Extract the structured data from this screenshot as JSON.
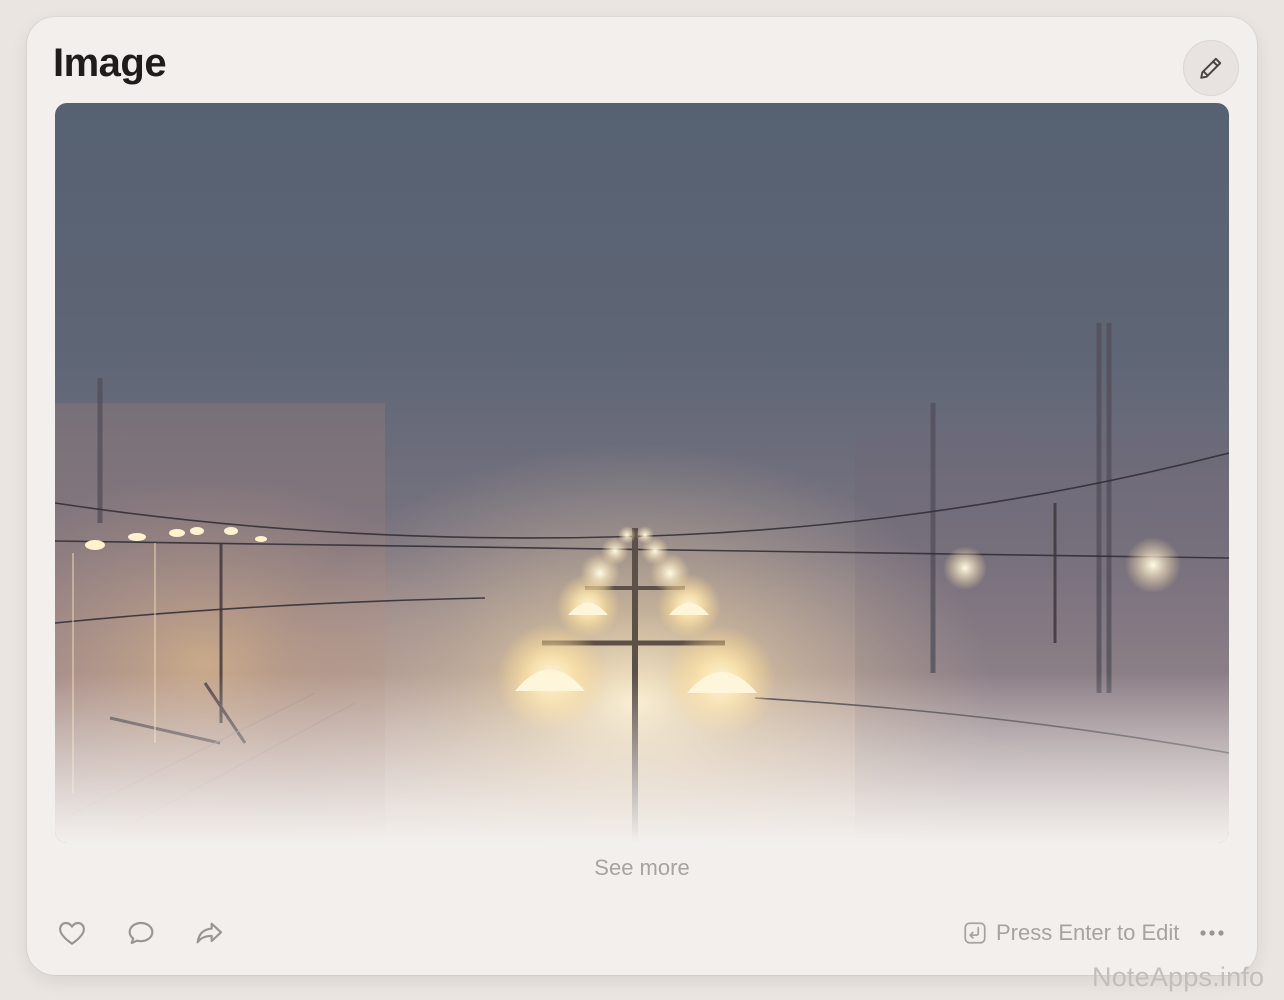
{
  "card": {
    "title": "Image",
    "edit_icon": "pencil-icon",
    "see_more_label": "See more"
  },
  "actions": {
    "like_icon": "heart-icon",
    "comment_icon": "comment-icon",
    "share_icon": "share-icon",
    "edit_hint_icon": "enter-key-icon",
    "edit_hint_label": "Press Enter to Edit",
    "more_icon": "ellipsis-icon"
  },
  "watermark": "NoteApps.info",
  "colors": {
    "card_background": "#f3efec",
    "page_background": "#ebe5e1",
    "title": "#1f1c1b",
    "muted_text": "#a8a29f",
    "lamp_glow": "#fff1c4"
  }
}
